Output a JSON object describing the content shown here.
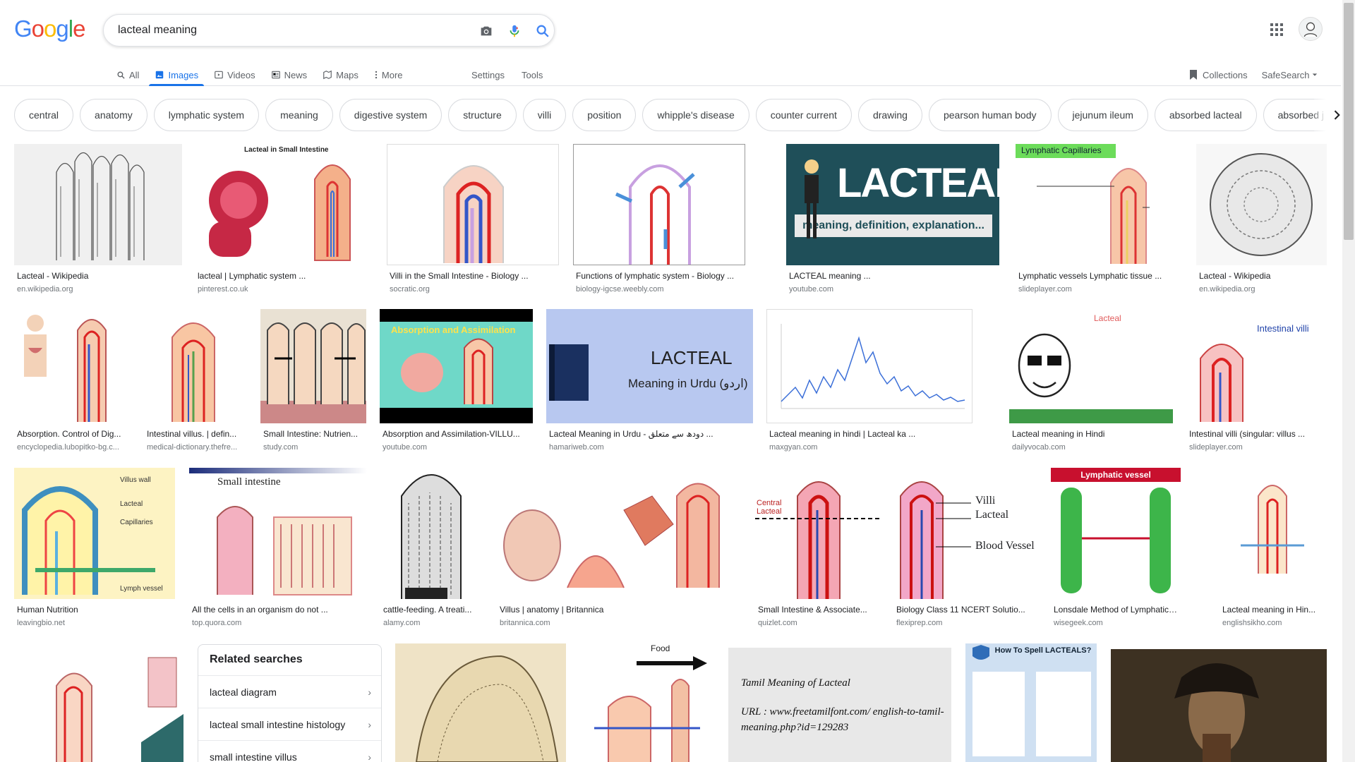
{
  "logo": {
    "letters": [
      "G",
      "o",
      "o",
      "g",
      "l",
      "e"
    ],
    "colors": [
      "#4285f4",
      "#ea4335",
      "#fbbc05",
      "#4285f4",
      "#34a853",
      "#ea4335"
    ]
  },
  "search": {
    "value": "lacteal meaning"
  },
  "nav": {
    "tabs": [
      {
        "label": "All",
        "icon": "search-icon"
      },
      {
        "label": "Images",
        "icon": "image-icon"
      },
      {
        "label": "Videos",
        "icon": "video-icon"
      },
      {
        "label": "News",
        "icon": "news-icon"
      },
      {
        "label": "Maps",
        "icon": "map-icon"
      },
      {
        "label": "More",
        "icon": "more-vert-icon"
      }
    ],
    "settings": "Settings",
    "tools": "Tools",
    "collections": "Collections",
    "safesearch": "SafeSearch"
  },
  "chips": [
    "central",
    "anatomy",
    "lymphatic system",
    "meaning",
    "digestive system",
    "structure",
    "villi",
    "position",
    "whipple's disease",
    "counter current",
    "drawing",
    "pearson human body",
    "jejunum ileum",
    "absorbed lacteal",
    "absorbed j"
  ],
  "results": [
    {
      "caption": "Lacteal - Wikipedia",
      "source": "en.wikipedia.org"
    },
    {
      "caption": "lacteal | Lymphatic system ...",
      "source": "pinterest.co.uk"
    },
    {
      "caption": "Villi in the Small Intestine - Biology ...",
      "source": "socratic.org"
    },
    {
      "caption": "Functions of lymphatic system - Biology ...",
      "source": "biology-igcse.weebly.com"
    },
    {
      "caption": "LACTEAL meaning ...",
      "source": "youtube.com"
    },
    {
      "caption": "Lymphatic vessels Lymphatic tissue ...",
      "source": "slideplayer.com"
    },
    {
      "caption": "Lacteal - Wikipedia",
      "source": "en.wikipedia.org"
    },
    {
      "caption": "Absorption. Control of Dig...",
      "source": "encyclopedia.lubopitko-bg.c..."
    },
    {
      "caption": "Intestinal villus. | defin...",
      "source": "medical-dictionary.thefre..."
    },
    {
      "caption": "Small Intestine: Nutrien...",
      "source": "study.com"
    },
    {
      "caption": "Absorption and Assimilation-VILLU...",
      "source": "youtube.com"
    },
    {
      "caption": "Lacteal Meaning in Urdu - دودھ سے متعلق ...",
      "source": "hamariweb.com"
    },
    {
      "caption": "Lacteal meaning in hindi | Lacteal ka ...",
      "source": "maxgyan.com"
    },
    {
      "caption": "Lacteal meaning in Hindi",
      "source": "dailyvocab.com"
    },
    {
      "caption": "Intestinal villi (singular: villus ...",
      "source": "slideplayer.com"
    },
    {
      "caption": "Human Nutrition",
      "source": "leavingbio.net"
    },
    {
      "caption": "All the cells in an organism do not ...",
      "source": "top.quora.com"
    },
    {
      "caption": "cattle-feeding. A treati...",
      "source": "alamy.com"
    },
    {
      "caption": "Villus | anatomy | Britannica",
      "source": "britannica.com"
    },
    {
      "caption": "Small Intestine & Associate...",
      "source": "quizlet.com"
    },
    {
      "caption": "Biology Class 11 NCERT Solutio...",
      "source": "flexiprep.com"
    },
    {
      "caption": "Lonsdale Method of Lymphatic Mas...",
      "source": "wisegeek.com"
    },
    {
      "caption": "Lacteal meaning in Hin...",
      "source": "englishsikho.com"
    }
  ],
  "thumb_text": {
    "lacteal_small_intestine": "Lacteal in Small Intestine",
    "lacteal_big": "LACTEAL",
    "lacteal_sub": "meaning, definition, explanation...",
    "lymph_caps": "Lymphatic Capillaries",
    "absorption": "Absorption and Assimilation",
    "urdu_title": "LACTEAL",
    "urdu_sub": "Meaning in Urdu (اردو)",
    "intestinal_villi": "Intestinal villi",
    "small_intestine": "Small intestine",
    "lymphatic_vessel": "Lymphatic vessel",
    "villi": "Villi",
    "lacteal": "Lacteal",
    "blood_vessel": "Blood Vessel",
    "central_lacteal": "Central Lacteal",
    "food": "Food",
    "how_to_spell": "How To Spell LACTEALS?",
    "tamil_title": "Tamil Meaning of Lacteal",
    "tamil_url": "URL : www.freetamilfont.com/ english-to-tamil-meaning.php?id=129283",
    "villus_wall": "Villus wall",
    "capillaries": "Capillaries",
    "lymph_vessel": "Lymph vessel"
  },
  "related": {
    "title": "Related searches",
    "items": [
      "lacteal diagram",
      "lacteal small intestine histology",
      "small intestine villus"
    ]
  }
}
